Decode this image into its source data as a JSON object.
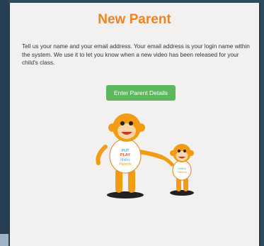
{
  "page": {
    "title": "New Parent",
    "description": "Tell us your name and your email address. Your email address is your login name within the system. We use it to let you know when a new video has been released for your child's class.",
    "button_label": "Enter Parent Details"
  },
  "illustration": {
    "big_shirt_text": "PUT PLAY Maths Parents",
    "small_shirt_text": "Maths Parents"
  }
}
